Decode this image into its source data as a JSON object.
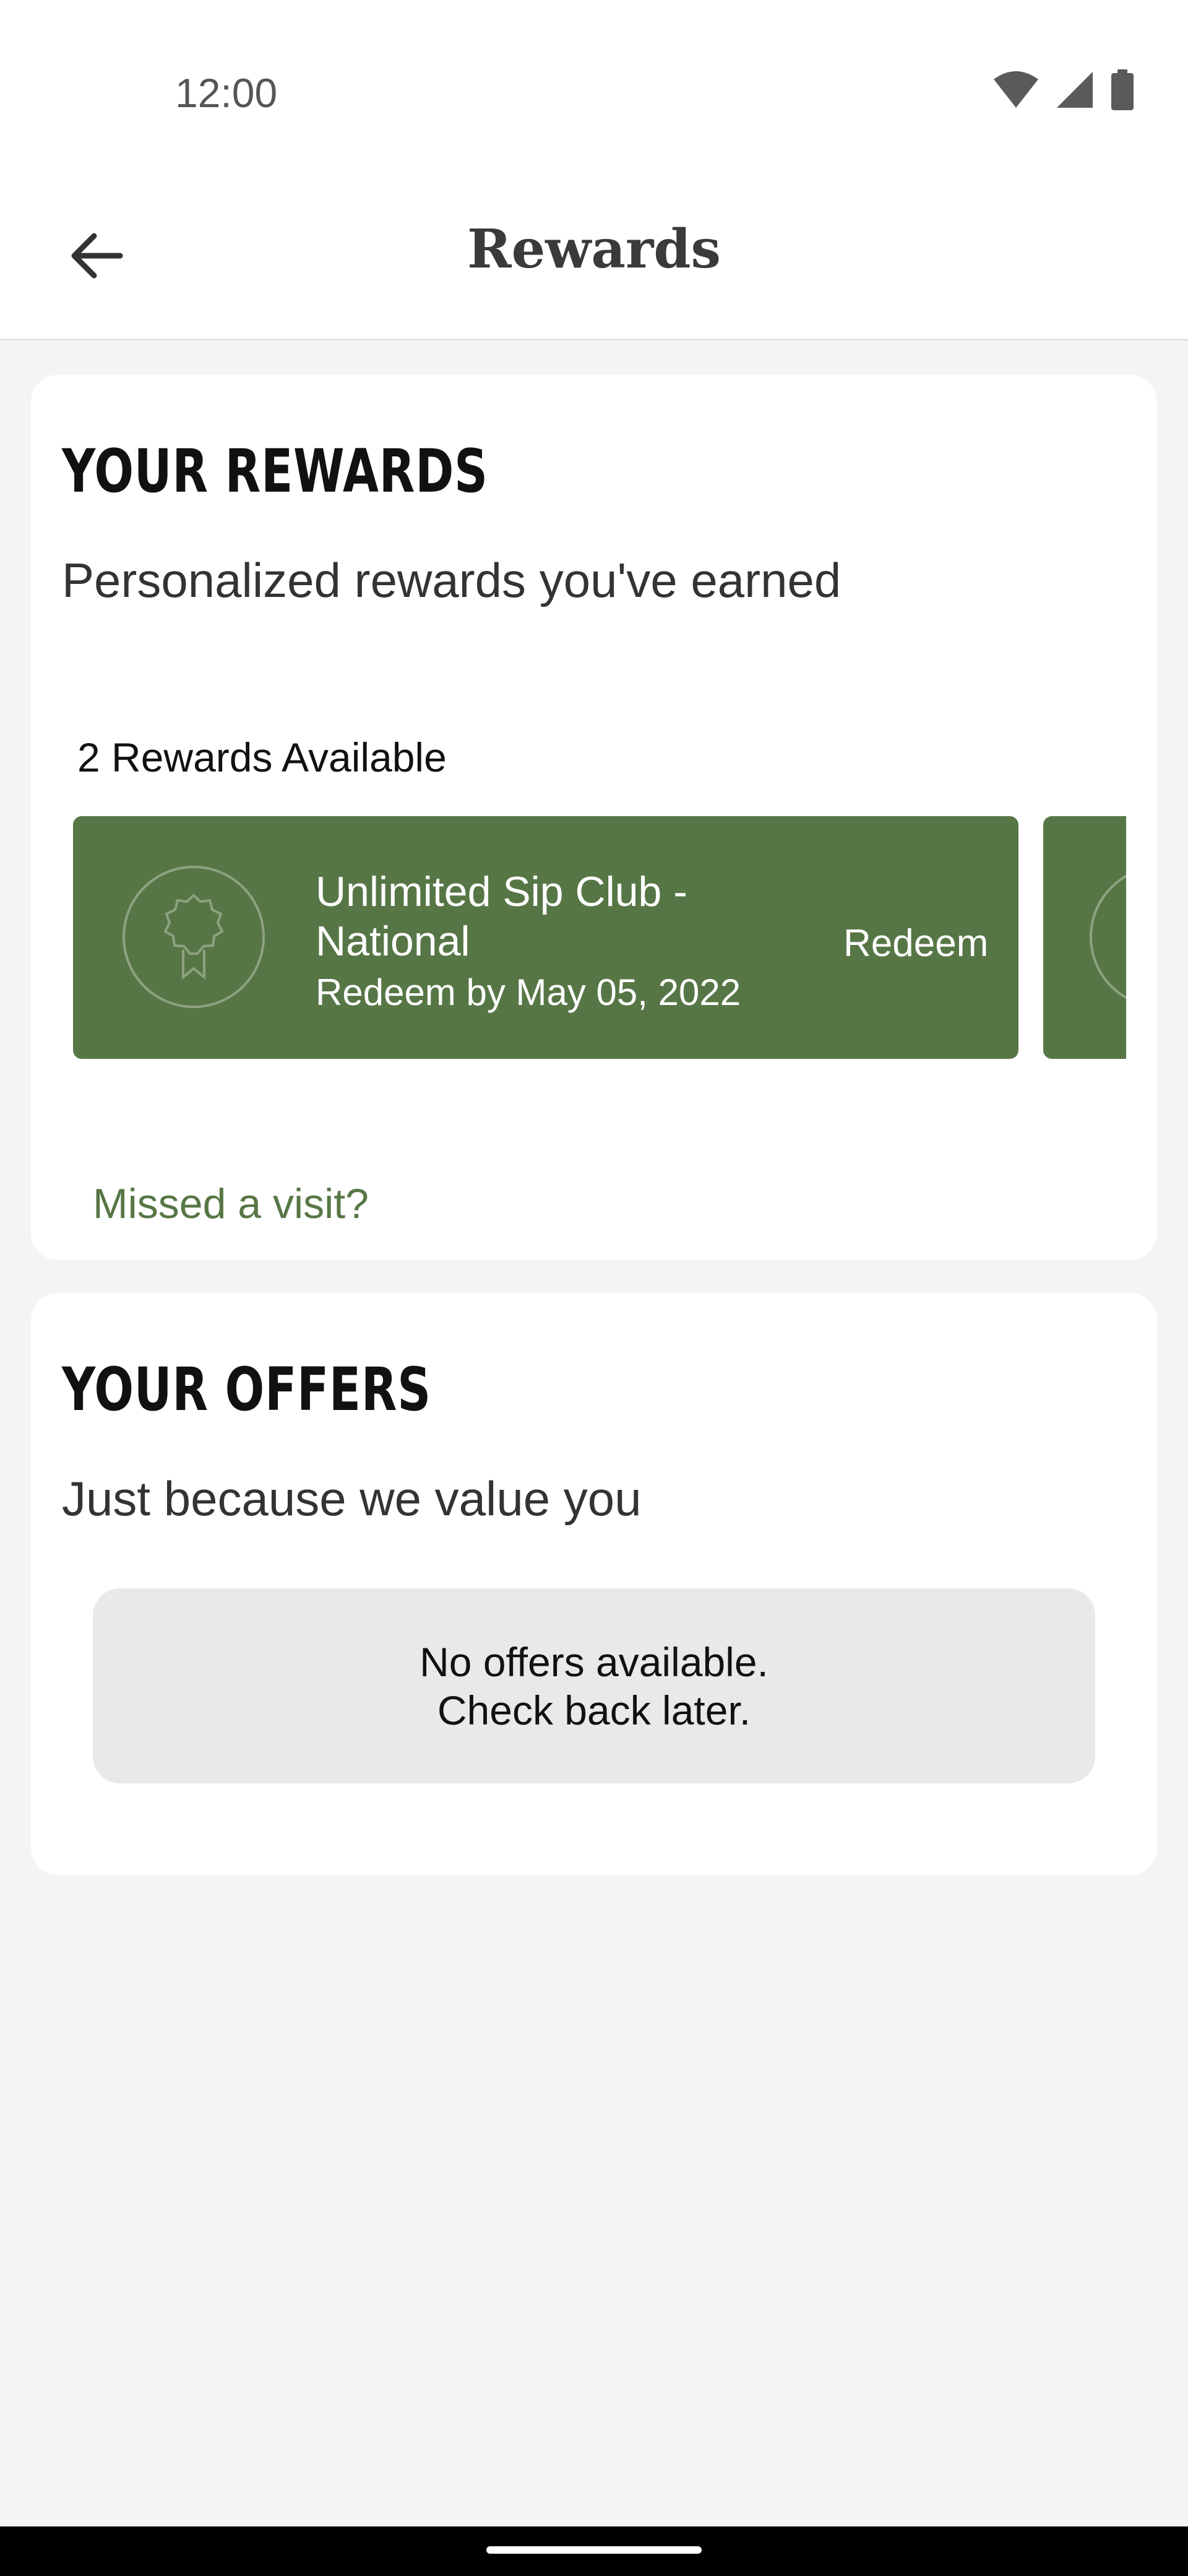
{
  "status_bar": {
    "time": "12:00",
    "icons": [
      "wifi-icon",
      "cell-signal-icon",
      "battery-icon"
    ]
  },
  "top_bar": {
    "back_icon": "arrow-left-icon",
    "title": "Rewards"
  },
  "rewards_section": {
    "heading": "YOUR REWARDS",
    "subtitle": "Personalized rewards you've earned",
    "available_count": "2 Rewards Available",
    "rewards": [
      {
        "name": "Unlimited Sip Club - National",
        "redeem_by": "Redeem by May 05, 2022",
        "action": "Redeem",
        "icon": "award-ribbon-icon"
      }
    ],
    "missed_visit_link": "Missed a visit?"
  },
  "offers_section": {
    "heading": "YOUR OFFERS",
    "subtitle": "Just because we value you",
    "empty_line1": "No offers available.",
    "empty_line2": "Check back later."
  },
  "colors": {
    "reward_green": "#577646",
    "background": "#f4f4f4",
    "card": "#ffffff"
  }
}
